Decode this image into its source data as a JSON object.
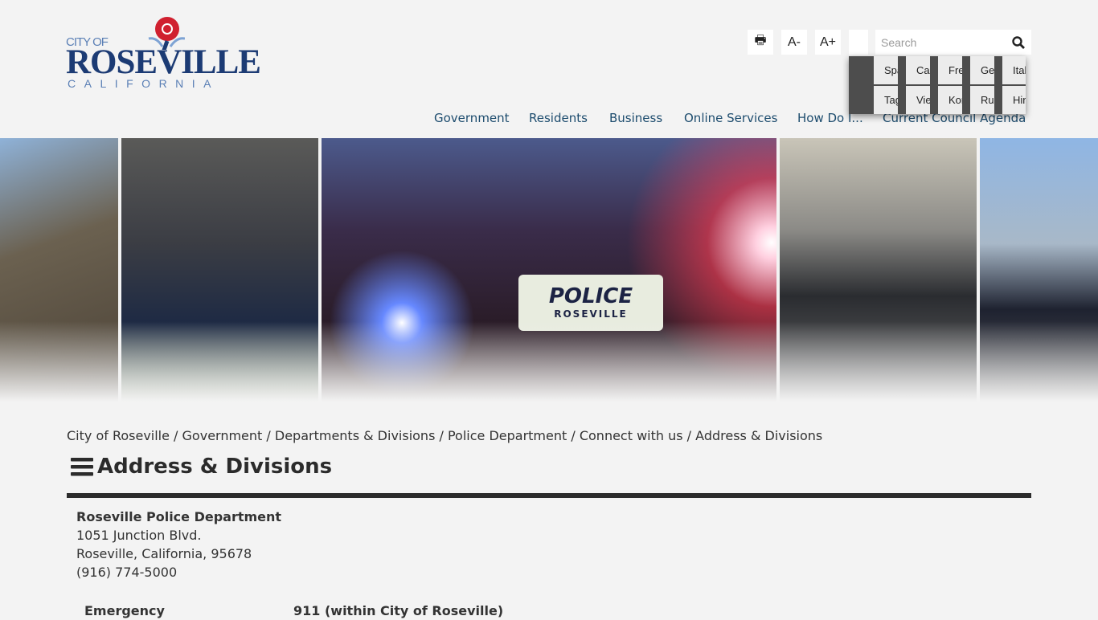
{
  "logo": {
    "city_of": "CITY OF",
    "name": "ROSEVILLE",
    "state": "CALIFORNIA"
  },
  "toolbar": {
    "print_icon": "print-icon",
    "decrease_font": "A-",
    "increase_font": "A+",
    "search_placeholder": "Search",
    "search_icon": "search-icon"
  },
  "languages": [
    "Spanish",
    "Cantonese",
    "French",
    "German",
    "Italian",
    "Tagalog",
    "Vietnamese",
    "Korean",
    "Russian",
    "Hindi"
  ],
  "language_visible": [
    "Spa",
    "Can",
    "Fre",
    "Ger",
    "Italian",
    "Taga",
    "Viet",
    "Kor",
    "Rus",
    "Hindi"
  ],
  "nav": [
    "Government",
    "Residents",
    "Business",
    "Online Services",
    "How Do I...",
    "Current Council Agenda"
  ],
  "hero": {
    "car_text": "POLICE",
    "car_sub": "ROSEVILLE"
  },
  "breadcrumb": [
    "City of Roseville",
    "Government",
    "Departments & Divisions",
    "Police Department",
    "Connect with us",
    "Address & Divisions"
  ],
  "page_title": "Address & Divisions",
  "address": {
    "name": "Roseville Police Department",
    "street": "1051 Junction Blvd.",
    "city": "Roseville, California, 95678",
    "phone": "(916) 774-5000"
  },
  "table": [
    {
      "label": "Emergency",
      "value": "911 (within City of Roseville)"
    }
  ],
  "colors": {
    "logo_blue": "#1c3b74",
    "rose_red": "#d0202f",
    "nav": "#1d4c6e",
    "rule": "#2b2b2b"
  }
}
